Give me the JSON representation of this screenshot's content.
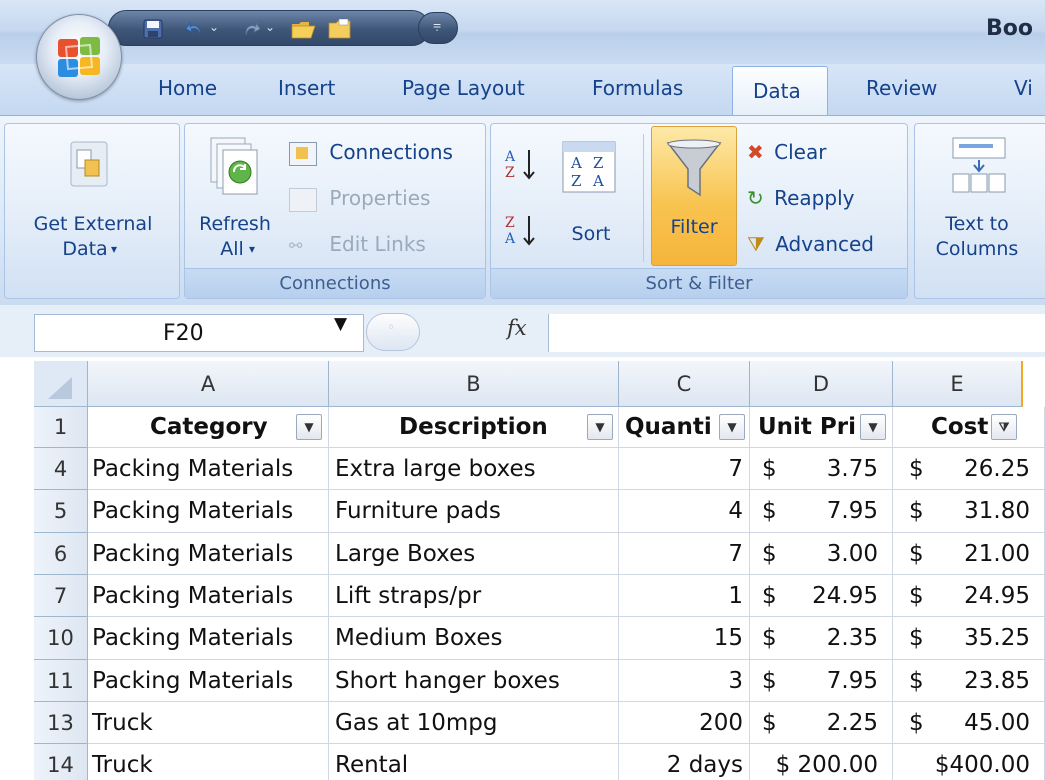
{
  "title_bar": {
    "document_title": "Boo"
  },
  "quick_access": {
    "icons": [
      "save-icon",
      "undo-icon",
      "redo-icon",
      "open-folder-icon",
      "folder-icon",
      "customize-icon"
    ]
  },
  "ribbon_tabs": [
    "Home",
    "Insert",
    "Page Layout",
    "Formulas",
    "Data",
    "Review",
    "Vi"
  ],
  "active_tab": "Data",
  "ribbon": {
    "get_external_data": {
      "label_line1": "Get External",
      "label_line2": "Data"
    },
    "connections_group": {
      "label": "Connections",
      "refresh_line1": "Refresh",
      "refresh_line2": "All",
      "connections": "Connections",
      "properties": "Properties",
      "edit_links": "Edit Links"
    },
    "sort_filter_group": {
      "label": "Sort & Filter",
      "sort": "Sort",
      "filter": "Filter",
      "clear": "Clear",
      "reapply": "Reapply",
      "advanced": "Advanced"
    },
    "text_to_columns": {
      "label_line1": "Text to",
      "label_line2": "Columns"
    }
  },
  "formula_bar": {
    "name_box": "F20",
    "fx_label": "fx",
    "formula": ""
  },
  "columns": [
    "A",
    "B",
    "C",
    "D",
    "E"
  ],
  "header_row": {
    "row_number": "1",
    "cells": [
      "Category",
      "Description",
      "Quanti",
      "Unit Pri",
      "Cost"
    ]
  },
  "rows": [
    {
      "row": "4",
      "category": "Packing Materials",
      "description": "Extra large boxes",
      "quantity": "7",
      "unit_cur": "$",
      "unit_price": "3.75",
      "cost_cur": "$",
      "cost": "26.25"
    },
    {
      "row": "5",
      "category": "Packing Materials",
      "description": "Furniture pads",
      "quantity": "4",
      "unit_cur": "$",
      "unit_price": "7.95",
      "cost_cur": "$",
      "cost": "31.80"
    },
    {
      "row": "6",
      "category": "Packing Materials",
      "description": "Large Boxes",
      "quantity": "7",
      "unit_cur": "$",
      "unit_price": "3.00",
      "cost_cur": "$",
      "cost": "21.00"
    },
    {
      "row": "7",
      "category": "Packing Materials",
      "description": "Lift straps/pr",
      "quantity": "1",
      "unit_cur": "$",
      "unit_price": "24.95",
      "cost_cur": "$",
      "cost": "24.95"
    },
    {
      "row": "10",
      "category": "Packing Materials",
      "description": "Medium Boxes",
      "quantity": "15",
      "unit_cur": "$",
      "unit_price": "2.35",
      "cost_cur": "$",
      "cost": "35.25"
    },
    {
      "row": "11",
      "category": "Packing Materials",
      "description": "Short hanger boxes",
      "quantity": "3",
      "unit_cur": "$",
      "unit_price": "7.95",
      "cost_cur": "$",
      "cost": "23.85"
    },
    {
      "row": "13",
      "category": "Truck",
      "description": "Gas at 10mpg",
      "quantity": "200",
      "unit_cur": "$",
      "unit_price": "2.25",
      "cost_cur": "$",
      "cost": "45.00"
    },
    {
      "row": "14",
      "category": "Truck",
      "description": "Rental",
      "quantity": "2 days",
      "unit_cur": "",
      "unit_price": "$ 200.00",
      "cost_cur": "",
      "cost": "$400.00"
    }
  ],
  "colors": {
    "ribbon_text": "#15428b",
    "filter_active": "#f8c451",
    "grid_line": "#d0d7e5"
  }
}
